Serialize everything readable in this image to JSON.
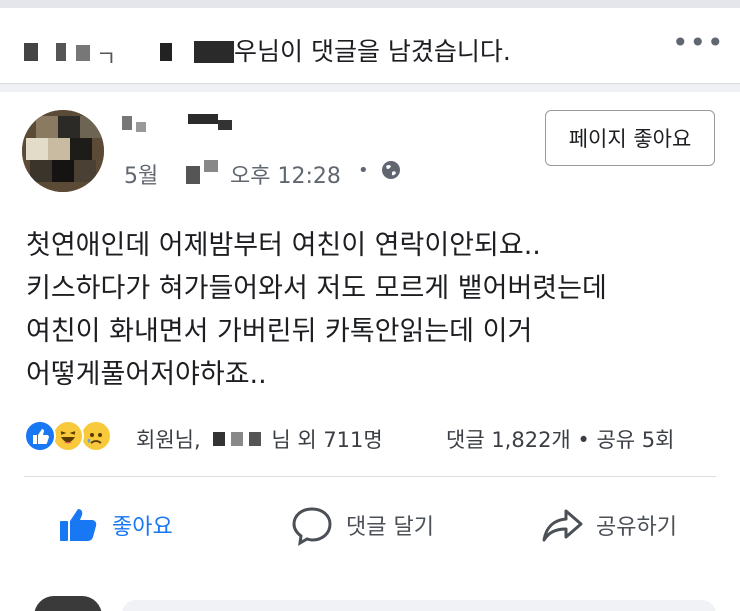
{
  "notification": {
    "text_suffix": "우님이 댓글을 남겼습니다.",
    "masked_prefix": "ㄱ"
  },
  "post": {
    "author_masked": true,
    "meta": {
      "date_prefix": "5월",
      "time": "오후 12:28",
      "separator": "•",
      "privacy_icon": "globe-icon"
    },
    "like_page_label": "페이지 좋아요",
    "body_lines": [
      "첫연애인데 어제밤부터 여친이 연락이안되요..",
      "키스하다가 혀가들어와서 저도 모르게 뱉어버렷는데",
      "여친이 화내면서 가버린뒤 카톡안읽는데 이거",
      "어떻게풀어저야하죠.."
    ],
    "reactions": {
      "icons": [
        "like-react-icon",
        "haha-react-icon",
        "sad-react-icon"
      ],
      "names_prefix": "회원님,",
      "names_suffix": "님 외 711명",
      "stats": "댓글 1,822개 • 공유 5회"
    },
    "actions": {
      "like": "좋아요",
      "comment": "댓글 달기",
      "share": "공유하기"
    }
  },
  "colors": {
    "accent": "#1877f2",
    "text": "#1c1e21",
    "muted": "#606770"
  }
}
